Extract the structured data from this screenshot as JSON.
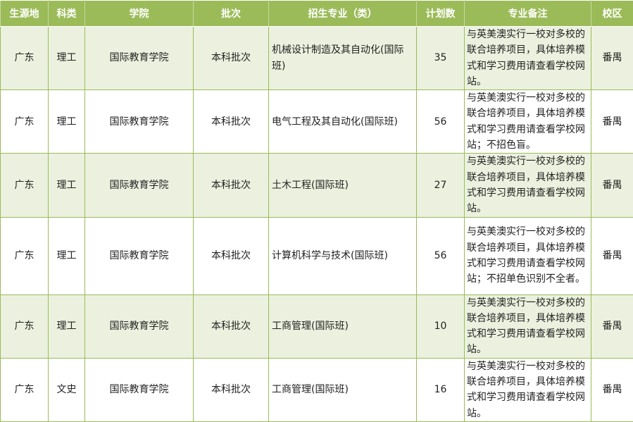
{
  "headers": [
    "生源地",
    "科类",
    "学院",
    "批次",
    "招生专业（类）",
    "计划数",
    "专业备注",
    "校区"
  ],
  "rows": [
    {
      "origin": "广东",
      "category": "理工",
      "college": "国际教育学院",
      "batch": "本科批次",
      "major": "机械设计制造及其自动化(国际班)",
      "plan": "35",
      "note": "与英美澳实行一校对多校的联合培养项目，具体培养模式和学习费用请查看学校网站。",
      "campus": "番禺"
    },
    {
      "origin": "广东",
      "category": "理工",
      "college": "国际教育学院",
      "batch": "本科批次",
      "major": "电气工程及其自动化(国际班)",
      "plan": "56",
      "note": "与英美澳实行一校对多校的联合培养项目，具体培养模式和学习费用请查看学校网站；不招色盲。",
      "campus": "番禺"
    },
    {
      "origin": "广东",
      "category": "理工",
      "college": "国际教育学院",
      "batch": "本科批次",
      "major": "土木工程(国际班)",
      "plan": "27",
      "note": "与英美澳实行一校对多校的联合培养项目，具体培养模式和学习费用请查看学校网站。",
      "campus": "番禺"
    },
    {
      "origin": "广东",
      "category": "理工",
      "college": "国际教育学院",
      "batch": "本科批次",
      "major": "计算机科学与技术(国际班)",
      "plan": "56",
      "note": "与英美澳实行一校对多校的联合培养项目，具体培养模式和学习费用请查看学校网站；不招单色识别不全者。",
      "campus": "番禺"
    },
    {
      "origin": "广东",
      "category": "理工",
      "college": "国际教育学院",
      "batch": "本科批次",
      "major": "工商管理(国际班)",
      "plan": "10",
      "note": "与英美澳实行一校对多校的联合培养项目，具体培养模式和学习费用请查看学校网站。",
      "campus": "番禺"
    },
    {
      "origin": "广东",
      "category": "文史",
      "college": "国际教育学院",
      "batch": "本科批次",
      "major": "工商管理(国际班)",
      "plan": "16",
      "note": "与英美澳实行一校对多校的联合培养项目，具体培养模式和学习费用请查看学校网站。",
      "campus": "番禺"
    }
  ]
}
